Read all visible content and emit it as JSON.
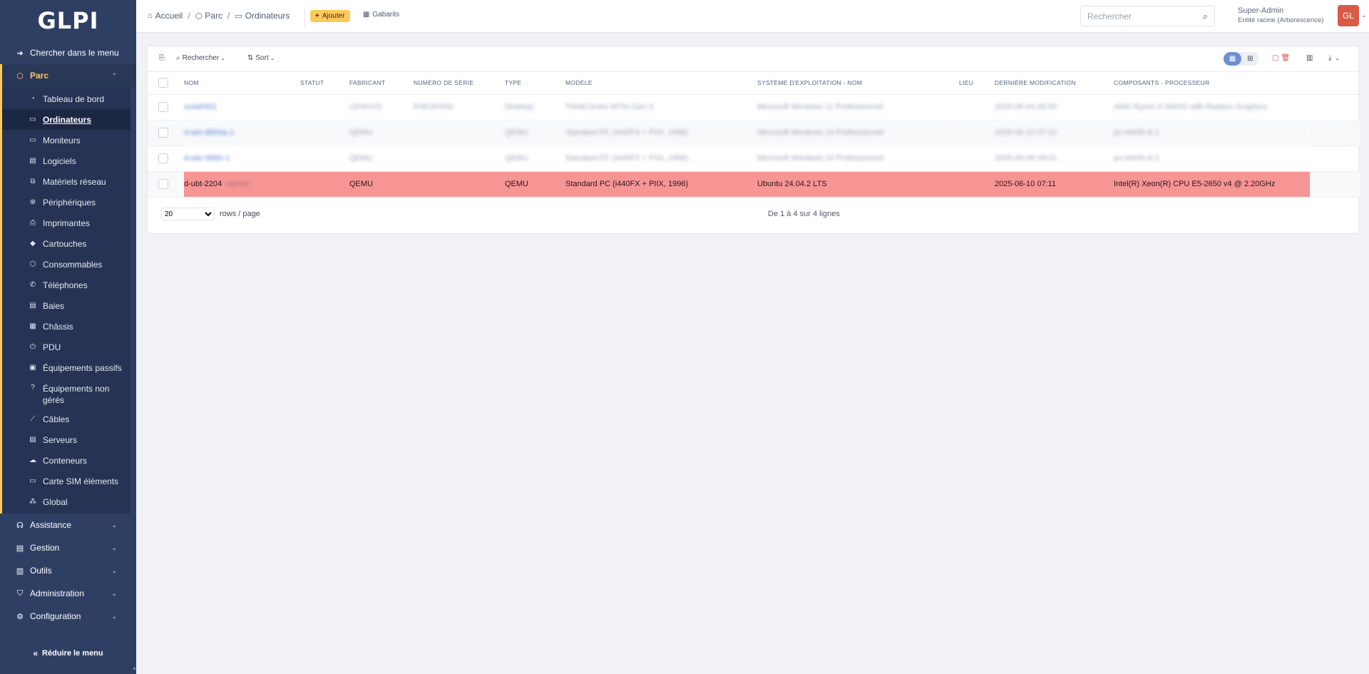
{
  "app": {
    "logo": "GLPI"
  },
  "sidebar": {
    "search_menu": "Chercher dans le menu",
    "parc": "Parc",
    "items": [
      {
        "label": "Tableau de bord",
        "icon": "dashboard-icon"
      },
      {
        "label": "Ordinateurs",
        "icon": "laptop-icon",
        "active": true
      },
      {
        "label": "Moniteurs",
        "icon": "monitor-icon"
      },
      {
        "label": "Logiciels",
        "icon": "software-icon"
      },
      {
        "label": "Matériels réseau",
        "icon": "network-icon"
      },
      {
        "label": "Périphériques",
        "icon": "devices-icon"
      },
      {
        "label": "Imprimantes",
        "icon": "printer-icon"
      },
      {
        "label": "Cartouches",
        "icon": "droplet-icon"
      },
      {
        "label": "Consommables",
        "icon": "package-icon"
      },
      {
        "label": "Téléphones",
        "icon": "phone-icon"
      },
      {
        "label": "Baies",
        "icon": "rack-icon"
      },
      {
        "label": "Châssis",
        "icon": "grid-icon"
      },
      {
        "label": "PDU",
        "icon": "plug-icon"
      },
      {
        "label": "Équipements passifs",
        "icon": "box-icon"
      },
      {
        "label": "Équipements non gérés",
        "icon": "question-icon"
      },
      {
        "label": "Câbles",
        "icon": "cable-icon"
      },
      {
        "label": "Serveurs",
        "icon": "server-icon"
      },
      {
        "label": "Conteneurs",
        "icon": "container-icon"
      },
      {
        "label": "Carte SIM éléments",
        "icon": "sim-icon"
      },
      {
        "label": "Global",
        "icon": "global-icon"
      }
    ],
    "groups": [
      "Assistance",
      "Gestion",
      "Outils",
      "Administration",
      "Configuration"
    ],
    "collapse": "Réduire le menu"
  },
  "header": {
    "breadcrumbs": [
      "Accueil",
      "Parc",
      "Ordinateurs"
    ],
    "add_label": "Ajouter",
    "templates_label": "Gabarits",
    "search_placeholder": "Rechercher",
    "user_name": "Super-Admin",
    "user_entity": "Entité racine (Arborescence)",
    "avatar_initials": "GL"
  },
  "toolbar": {
    "search_label": "Rechercher",
    "sort_label": "Sort"
  },
  "table": {
    "columns": [
      "Nom",
      "Statut",
      "Fabricant",
      "Numéro de série",
      "Type",
      "Modèle",
      "Système d'exploitation - Nom",
      "Lieu",
      "Dernière modification",
      "Composants - Processeur"
    ],
    "rows": [
      {
        "nom": "ucedr001",
        "statut": "",
        "fabricant": "LENOVO",
        "serie": "R4KDF9X0",
        "type": "Desktop",
        "modele": "ThinkCentre M70s Gen 3",
        "os": "Microsoft Windows 11 Professionnel",
        "lieu": "",
        "modif": "2025-06-04 08:09",
        "cpu": "AMD Ryzen 5 5600G with Radeon Graphics",
        "blurred": true
      },
      {
        "nom": "d-win-8600a-1",
        "statut": "",
        "fabricant": "QEMU",
        "serie": "",
        "type": "QEMU",
        "modele": "Standard PC (i440FX + PIIX, 1996)",
        "os": "Microsoft Windows 10 Professionnel",
        "lieu": "",
        "modif": "2025-06-10 07:10",
        "cpu": "pc-i440fx-8.2",
        "blurred": true
      },
      {
        "nom": "d-win-9500-1",
        "statut": "",
        "fabricant": "QEMU",
        "serie": "",
        "type": "QEMU",
        "modele": "Standard PC (i440FX + PIIX, 1996)",
        "os": "Microsoft Windows 10 Professionnel",
        "lieu": "",
        "modif": "2025-06-09 09:01",
        "cpu": "pc-i440fx-8.2",
        "blurred": true
      },
      {
        "nom": "d-ubt-2204",
        "nom_suffix": "-server",
        "statut": "",
        "fabricant": "QEMU",
        "serie": "",
        "type": "QEMU",
        "modele": "Standard PC (i440FX + PIIX, 1996)",
        "os": "Ubuntu 24.04.2 LTS",
        "lieu": "",
        "modif": "2025-06-10 07:11",
        "cpu": "Intel(R) Xeon(R) CPU E5-2650 v4 @ 2.20GHz",
        "blurred": false,
        "highlighted": true
      }
    ]
  },
  "pager": {
    "rows_value": "20",
    "rows_label": "rows / page",
    "count_text": "De 1 à 4 sur 4 lignes"
  },
  "colors": {
    "sidebar": "#2f3f64",
    "accent": "#fec95c",
    "highlight": "#f79595",
    "avatar": "#d95a45"
  }
}
